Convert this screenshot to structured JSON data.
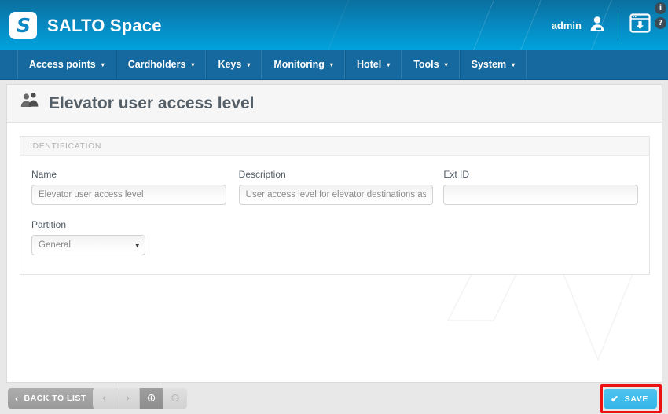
{
  "header": {
    "logo_letter": "S",
    "brand": "SALTO Space",
    "user_label": "admin",
    "avatar_icon": "user-avatar-icon",
    "download_icon": "download-window-icon",
    "info_icon": "i",
    "help_icon": "?",
    "accent_color": "#00a3dd"
  },
  "nav": {
    "caret": "▾",
    "items": [
      {
        "label": "Access points"
      },
      {
        "label": "Cardholders"
      },
      {
        "label": "Keys"
      },
      {
        "label": "Monitoring"
      },
      {
        "label": "Hotel"
      },
      {
        "label": "Tools"
      },
      {
        "label": "System"
      }
    ]
  },
  "page": {
    "title": "Elevator user access level",
    "title_icon": "users-icon"
  },
  "form": {
    "section_title": "IDENTIFICATION",
    "name": {
      "label": "Name",
      "value": "Elevator user access level",
      "placeholder": ""
    },
    "description": {
      "label": "Description",
      "value": "User access level for elevator destinations assignment",
      "placeholder": ""
    },
    "ext_id": {
      "label": "Ext ID",
      "value": "",
      "placeholder": ""
    },
    "partition": {
      "label": "Partition",
      "value": "General",
      "caret": "▾",
      "options": [
        "General"
      ]
    }
  },
  "footer": {
    "back_label": "BACK TO LIST",
    "back_chevron": "‹",
    "prev_label": "‹",
    "next_label": "›",
    "add_label": "⊕",
    "remove_label": "⊖",
    "save_label": "SAVE",
    "save_check": "✔",
    "save_color": "#34b6e8",
    "highlight_color": "#ee1111"
  }
}
